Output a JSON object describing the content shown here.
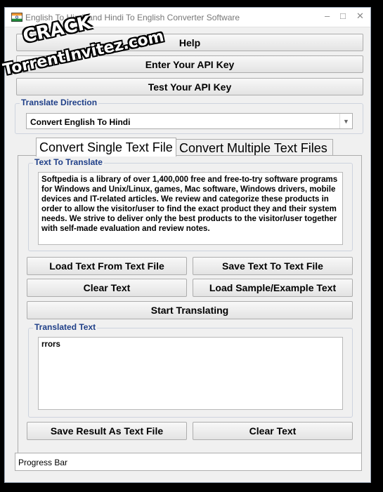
{
  "window": {
    "title": "English To Hindi and Hindi To English Converter Software",
    "minimize_glyph": "–",
    "maximize_glyph": "□",
    "close_glyph": "✕"
  },
  "toolbar": {
    "help_label": "Help",
    "enter_api_key_label": "Enter Your API Key",
    "test_api_key_label": "Test Your API Key"
  },
  "translate_direction": {
    "legend": "Translate Direction",
    "selected": "Convert English To Hindi"
  },
  "tabs": [
    {
      "label": "Convert Single Text File",
      "active": true
    },
    {
      "label": "Convert Multiple Text Files",
      "active": false
    }
  ],
  "text_to_translate": {
    "legend": "Text To Translate",
    "value": "Softpedia is a library of over 1,400,000 free and free-to-try software programs for Windows and Unix/Linux, games, Mac software, Windows drivers, mobile devices and IT-related articles. We review and categorize these products in order to allow the visitor/user to find the exact product they and their system needs. We strive to deliver only the best products to the visitor/user together with self-made evaluation and review notes."
  },
  "actions": {
    "load_text_label": "Load Text From Text File",
    "save_text_label": "Save Text To Text File",
    "clear_text_label": "Clear Text",
    "load_sample_label": "Load Sample/Example Text",
    "start_translating_label": "Start Translating"
  },
  "translated_text": {
    "legend": "Translated Text",
    "value": "rrors"
  },
  "result_actions": {
    "save_result_label": "Save Result As Text File",
    "clear_text_label": "Clear Text"
  },
  "status": {
    "progress_label": "Progress Bar"
  },
  "watermark": {
    "line1": "CRACK",
    "line2": "TorrentInvitez.com"
  },
  "icons": {
    "app": "india-flag-icon",
    "dropdown": "chevron-down-icon"
  }
}
